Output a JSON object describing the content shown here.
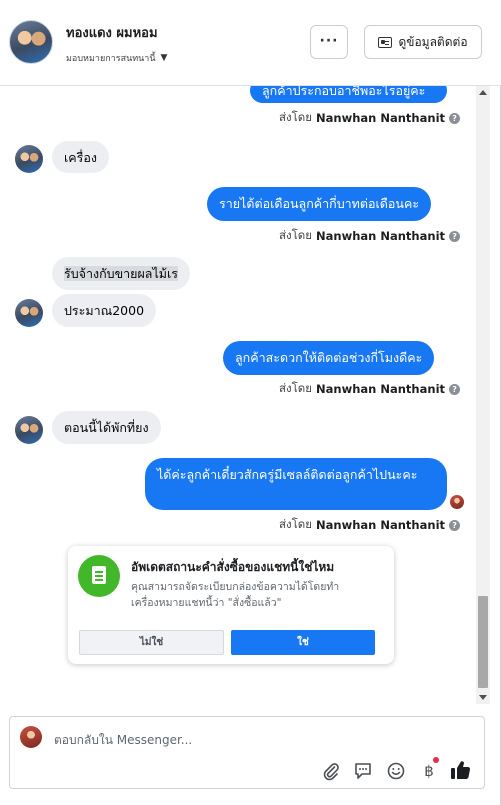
{
  "header": {
    "contact_name": "ทองแดง ผมหอม",
    "assign_label": "มอบหมายการสนทนานี้",
    "more_label": "···",
    "contact_info_label": "ดูข้อมูลติดต่อ"
  },
  "conversation": {
    "sent_by_prefix": "ส่งโดย",
    "sender_name": "Nanwhan Nanthanit",
    "messages": [
      {
        "from": "page",
        "text": "ลูกค้าประกอบอาชีพอะไรอยู่คะ"
      },
      {
        "from": "customer",
        "text": "เครื่อง"
      },
      {
        "from": "page",
        "text": "รายได้ต่อเดือนลูกค้ากี่บาทต่อเดือนคะ"
      },
      {
        "from": "customer",
        "text": "รับจ้างกับขายผลไม้เร"
      },
      {
        "from": "customer",
        "text": "ประมาณ2000"
      },
      {
        "from": "page",
        "text": "ลูกค้าสะดวกให้ติดต่อช่วงกี่โมงดีคะ"
      },
      {
        "from": "customer",
        "text": "ตอนนี้ได้พักที่ยง"
      },
      {
        "from": "page",
        "text": "ได้ค่ะลูกค้าเดี๋ยวสักครู่มีเซลล์ติดต่อลูกค้าไปนะคะ"
      }
    ]
  },
  "order_prompt": {
    "title": "อัพเดตสถานะคำสั่งซื้อของแชทนี้ใช่ไหม",
    "description": "คุณสามารถจัดระเบียบกล่องข้อความได้โดยทำเครื่องหมายแชทนี้ว่า \"สั่งซื้อแล้ว\"",
    "no_label": "ไม่ใช่",
    "yes_label": "ใช่"
  },
  "composer": {
    "placeholder": "ตอบกลับใน Messenger...",
    "icons": [
      "paperclip-icon",
      "message-template-icon",
      "emoji-icon",
      "baht-payment-icon",
      "thumbs-up-icon"
    ],
    "baht_symbol": "฿"
  },
  "colors": {
    "accent": "#1877f2",
    "order_icon": "#42b72a",
    "notification_dot": "#f02849"
  }
}
